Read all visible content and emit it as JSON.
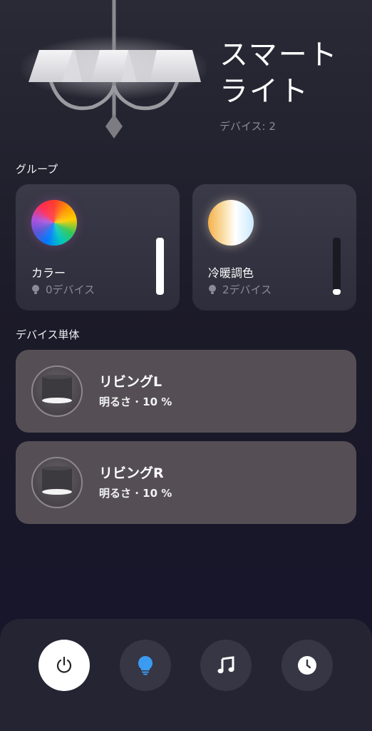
{
  "header": {
    "title_line1": "スマート",
    "title_line2": "ライト",
    "device_count": "デバイス: 2"
  },
  "sections": {
    "groups_label": "グループ",
    "devices_label": "デバイス単体"
  },
  "groups": [
    {
      "name": "カラー",
      "devices": "0デバイス",
      "level": 1.0,
      "swatch": "rgb-color-wheel"
    },
    {
      "name": "冷暖調色",
      "devices": "2デバイス",
      "level": 0.1,
      "swatch": "warm-cool-gradient"
    }
  ],
  "devices": [
    {
      "name": "リビングL",
      "status": "明るさ · 10 %"
    },
    {
      "name": "リビングR",
      "status": "明るさ · 10 %"
    }
  ],
  "tabbar": {
    "items": [
      {
        "icon": "power-icon",
        "active": true
      },
      {
        "icon": "lightbulb-icon",
        "active": false
      },
      {
        "icon": "music-note-icon",
        "active": false
      },
      {
        "icon": "clock-icon",
        "active": false
      }
    ]
  },
  "colors": {
    "accent_blue": "#3a9bf0",
    "device_card": "#554f55",
    "group_card": "#353442",
    "background": "#1c1b29"
  }
}
